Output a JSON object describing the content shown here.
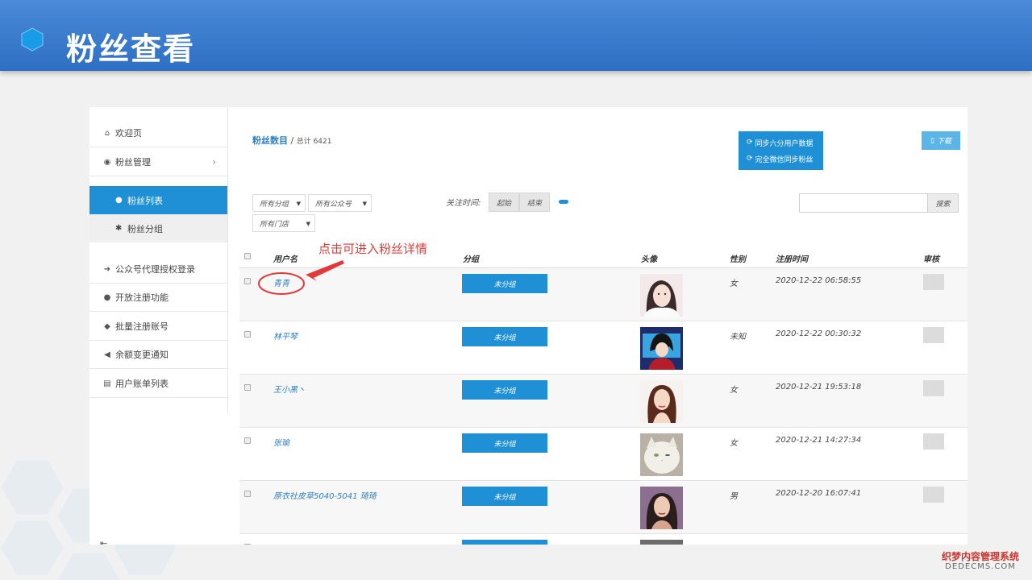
{
  "banner": {
    "title": "粉丝查看"
  },
  "sidebar": {
    "items": [
      {
        "label": "欢迎页",
        "icon": "home-icon",
        "glyph": "⌂"
      },
      {
        "label": "粉丝管理",
        "icon": "wechat-icon",
        "glyph": "◉"
      },
      {
        "label": "公众号代理授权登录",
        "icon": "sign-in-icon",
        "glyph": "➜"
      },
      {
        "label": "开放注册功能",
        "icon": "user-icon",
        "glyph": "●"
      },
      {
        "label": "批量注册账号",
        "icon": "android-icon",
        "glyph": "◆"
      },
      {
        "label": "余额变更通知",
        "icon": "bullhorn-icon",
        "glyph": "◀"
      },
      {
        "label": "用户账单列表",
        "icon": "list-icon",
        "glyph": "▤"
      }
    ],
    "sub_items": [
      {
        "label": "粉丝列表",
        "icon": "user-icon",
        "glyph": "●",
        "active": true
      },
      {
        "label": "粉丝分组",
        "icon": "gear-icon",
        "glyph": "✱",
        "active": false
      }
    ]
  },
  "breadcrumb": {
    "title": "粉丝数目",
    "separator": "/",
    "total": "总计 6421"
  },
  "toolbar": {
    "sync_six_label": "同步六分用户数据",
    "sync_full_label": "完全微信同步粉丝",
    "download_label": "下载"
  },
  "filters": {
    "group_select": "所有分组",
    "account_select": "所有公众号",
    "store_select": "所有门店",
    "follow_time_label": "关注时间:",
    "start_label": "起始",
    "end_label": "结束",
    "search_button": "搜索",
    "search_value": ""
  },
  "annotation": {
    "text": "点击可进入粉丝详情"
  },
  "table": {
    "headers": [
      "用户名",
      "分组",
      "头像",
      "性别",
      "注册时间",
      "审核"
    ],
    "rows": [
      {
        "username": "青青",
        "group": "未分组",
        "gender": "女",
        "reg_time": "2020-12-22 06:58:55",
        "avatar": "avatar-girl-white"
      },
      {
        "username": "林平琴",
        "group": "未分组",
        "gender": "未知",
        "reg_time": "2020-12-22 00:30:32",
        "avatar": "avatar-anime-boy"
      },
      {
        "username": "王小黑丶",
        "group": "未分组",
        "gender": "女",
        "reg_time": "2020-12-21 19:53:18",
        "avatar": "avatar-illustrated-woman"
      },
      {
        "username": "张瑜",
        "group": "未分组",
        "gender": "女",
        "reg_time": "2020-12-21 14:27:34",
        "avatar": "avatar-white-cat"
      },
      {
        "username": "原衣社皮草5040-5041 琦琦",
        "group": "未分组",
        "gender": "男",
        "reg_time": "2020-12-20 16:07:41",
        "avatar": "avatar-woman-photo"
      }
    ]
  },
  "watermark": {
    "line1": "织梦内容管理系统",
    "line2": "DEDECMS.COM"
  },
  "colors": {
    "banner": "#2f6fc3",
    "accent": "#1f8fd6",
    "link": "#2a7fc1",
    "annotation": "#e23a3a"
  }
}
